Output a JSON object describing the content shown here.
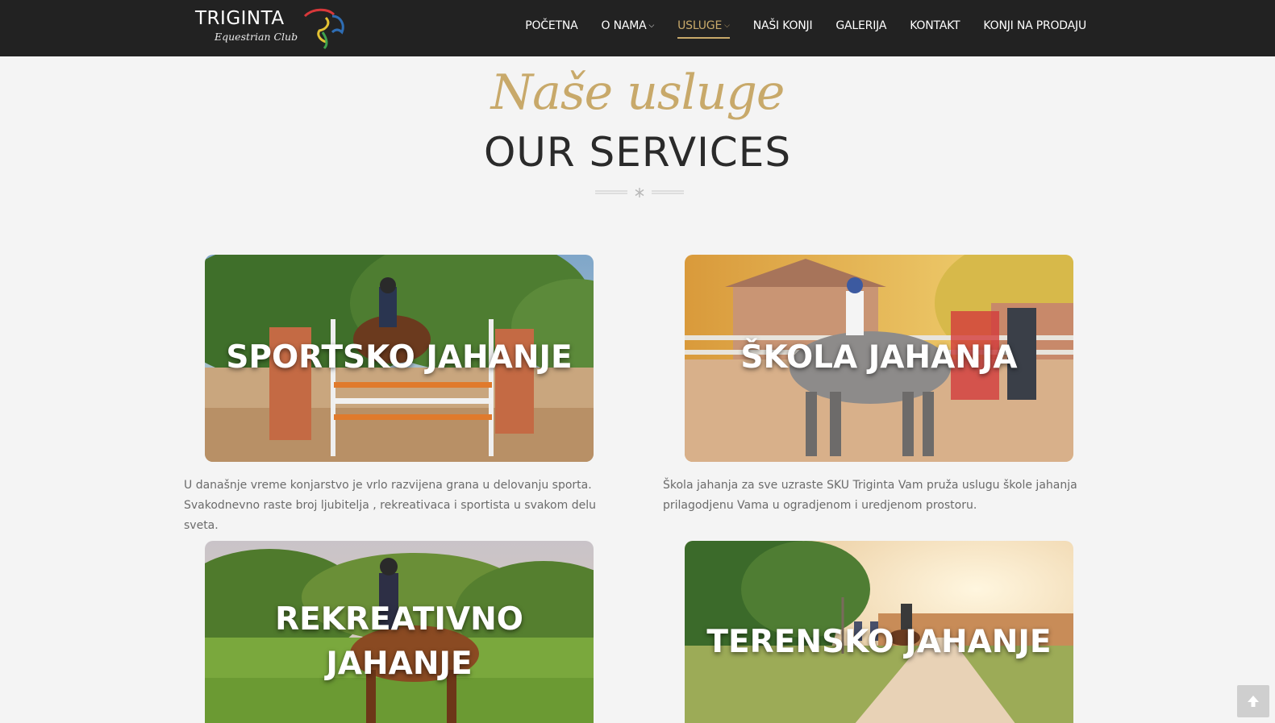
{
  "header": {
    "logo_text": "TRIGINTA",
    "logo_subtitle": "Equestrian Club",
    "nav": [
      {
        "label": "POČETNA",
        "active": false,
        "dropdown": false
      },
      {
        "label": "O NAMA",
        "active": false,
        "dropdown": true
      },
      {
        "label": "USLUGE",
        "active": true,
        "dropdown": true
      },
      {
        "label": "NAŠI KONJI",
        "active": false,
        "dropdown": false
      },
      {
        "label": "GALERIJA",
        "active": false,
        "dropdown": false
      },
      {
        "label": "KONTAKT",
        "active": false,
        "dropdown": false
      },
      {
        "label": "KONJI NA PRODAJU",
        "active": false,
        "dropdown": false
      }
    ]
  },
  "section": {
    "script_title": "Naše usluge",
    "title": "OUR SERVICES"
  },
  "services": [
    {
      "title": "SPORTSKO JAHANJE",
      "description_line1": "U današnje vreme konjarstvo je vrlo razvijena grana u delovanju sporta.",
      "description_line2": "Svakodnevno raste broj ljubitelja , rekreativaca i sportista  u svakom delu sveta."
    },
    {
      "title": "ŠKOLA JAHANJA",
      "description_line1": "Škola jahanja za sve uzraste SKU Triginta Vam pruža uslugu škole jahanja",
      "description_line2": "prilagodjenu Vama  u ogradjenom i uredjenom prostoru."
    },
    {
      "title_line1": "REKREATIVNO",
      "title_line2": "JAHANJE"
    },
    {
      "title": "TERENSKO JAHANJE"
    }
  ],
  "colors": {
    "header_bg": "#222222",
    "accent_gold": "#c8a96a",
    "page_bg": "#f4f4f4",
    "text_gray": "#6b6b6b"
  },
  "icons": {
    "scroll_top": "arrow-up-icon",
    "divider": "asterisk-icon",
    "dropdown": "chevron-down-icon"
  }
}
